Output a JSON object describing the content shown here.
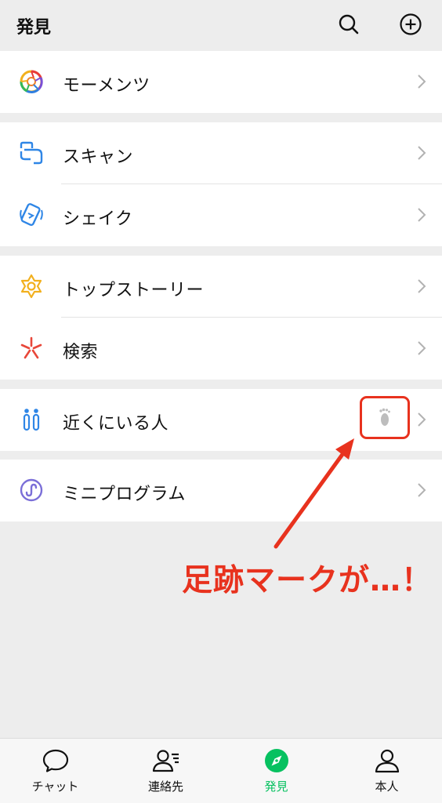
{
  "header": {
    "title": "発見"
  },
  "sections": [
    {
      "items": [
        {
          "label": "モーメンツ",
          "icon": "moments-icon"
        }
      ]
    },
    {
      "items": [
        {
          "label": "スキャン",
          "icon": "scan-icon"
        },
        {
          "label": "シェイク",
          "icon": "shake-icon"
        }
      ]
    },
    {
      "items": [
        {
          "label": "トップストーリー",
          "icon": "top-stories-icon"
        },
        {
          "label": "検索",
          "icon": "search-feature-icon"
        }
      ]
    },
    {
      "items": [
        {
          "label": "近くにいる人",
          "icon": "people-nearby-icon",
          "badge": "footprint-icon"
        }
      ]
    },
    {
      "items": [
        {
          "label": "ミニプログラム",
          "icon": "mini-program-icon"
        }
      ]
    }
  ],
  "annotation": {
    "text": "足跡マークが…！",
    "color": "#e8321e"
  },
  "tabbar": {
    "tabs": [
      {
        "label": "チャット",
        "icon": "chat-icon",
        "active": false
      },
      {
        "label": "連絡先",
        "icon": "contacts-icon",
        "active": false
      },
      {
        "label": "発見",
        "icon": "discover-icon",
        "active": true
      },
      {
        "label": "本人",
        "icon": "me-icon",
        "active": false
      }
    ],
    "active_color": "#07c160"
  }
}
